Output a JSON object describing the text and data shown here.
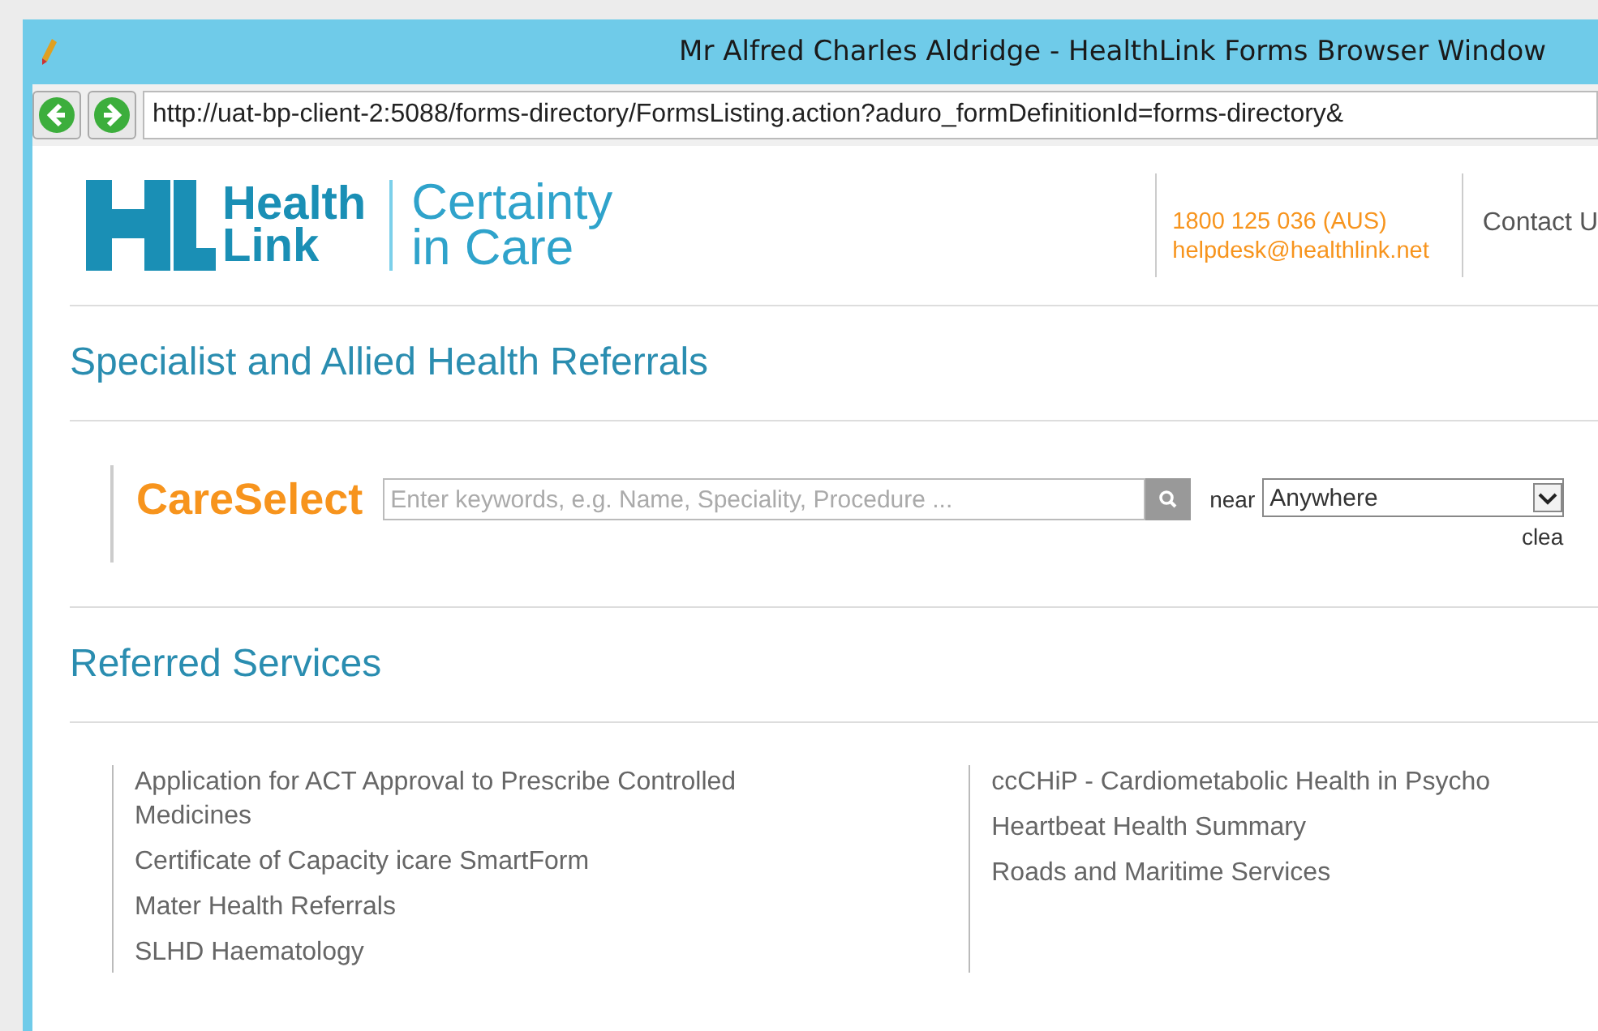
{
  "window": {
    "title": "Mr Alfred Charles Aldridge - HealthLink Forms Browser Window"
  },
  "address_bar": {
    "url": "http://uat-bp-client-2:5088/forms-directory/FormsListing.action?aduro_formDefinitionId=forms-directory&"
  },
  "header": {
    "brand": [
      "Health",
      "Link"
    ],
    "tagline": [
      "Certainty",
      "in Care"
    ],
    "phone": "1800 125 036 (AUS)",
    "email": "helpdesk@healthlink.net",
    "contact": "Contact U"
  },
  "section_title": "Specialist and Allied Health Referrals",
  "careselect": {
    "brand": "CareSelect",
    "search_placeholder": "Enter keywords, e.g. Name, Speciality, Procedure ...",
    "near_label": "near",
    "location": "Anywhere",
    "clear": "clea"
  },
  "referred_services": {
    "title": "Referred Services",
    "columns": [
      [
        "Application for ACT Approval to Prescribe Controlled Medicines",
        "Certificate of Capacity icare SmartForm",
        "Mater Health Referrals",
        "SLHD Haematology"
      ],
      [
        "ccCHiP - Cardiometabolic Health in Psycho",
        "Heartbeat Health Summary",
        "Roads and Maritime Services"
      ]
    ]
  }
}
